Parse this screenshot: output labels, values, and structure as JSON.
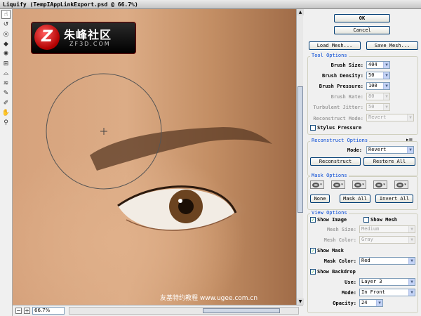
{
  "window": {
    "title": "Liquify (TempIAppLinkExport.psd @ 66.7%)"
  },
  "logo": {
    "cn": "朱峰社区",
    "en": "ZF3D.COM"
  },
  "watermark": "友基特约教程  www.ugee.com.cn",
  "statusbar": {
    "zoom": "66.7%",
    "zoom_in": "+",
    "zoom_out": "−"
  },
  "panel": {
    "ok_label": "OK",
    "cancel_label": "Cancel",
    "load_mesh_label": "Load Mesh...",
    "save_mesh_label": "Save Mesh...",
    "tool_options": {
      "title": "Tool Options",
      "brush_size_label": "Brush Size:",
      "brush_size": "404",
      "brush_density_label": "Brush Density:",
      "brush_density": "50",
      "brush_pressure_label": "Brush Pressure:",
      "brush_pressure": "100",
      "brush_rate_label": "Brush Rate:",
      "brush_rate": "80",
      "turbulent_jitter_label": "Turbulent Jitter:",
      "turbulent_jitter": "50",
      "reconstruct_mode_label": "Reconstruct Mode:",
      "reconstruct_mode": "Revert",
      "stylus_pressure_label": "Stylus Pressure"
    },
    "reconstruct_options": {
      "title": "Reconstruct Options",
      "mode_label": "Mode:",
      "mode": "Revert",
      "reconstruct_label": "Reconstruct",
      "restore_all_label": "Restore All"
    },
    "mask_options": {
      "title": "Mask Options",
      "none_label": "None",
      "mask_all_label": "Mask All",
      "invert_all_label": "Invert All"
    },
    "view_options": {
      "title": "View Options",
      "show_image_label": "Show Image",
      "show_mesh_label": "Show Mesh",
      "mesh_size_label": "Mesh Size:",
      "mesh_size": "Medium",
      "mesh_color_label": "Mesh Color:",
      "mesh_color": "Gray",
      "show_mask_label": "Show Mask",
      "mask_color_label": "Mask Color:",
      "mask_color": "Red",
      "show_backdrop_label": "Show Backdrop",
      "use_label": "Use:",
      "use": "Layer 3",
      "mode_label": "Mode:",
      "mode": "In Front",
      "opacity_label": "Opacity:",
      "opacity": "24"
    }
  },
  "colors": {
    "accent": "#0046d5",
    "skin": "#d6a27c"
  }
}
